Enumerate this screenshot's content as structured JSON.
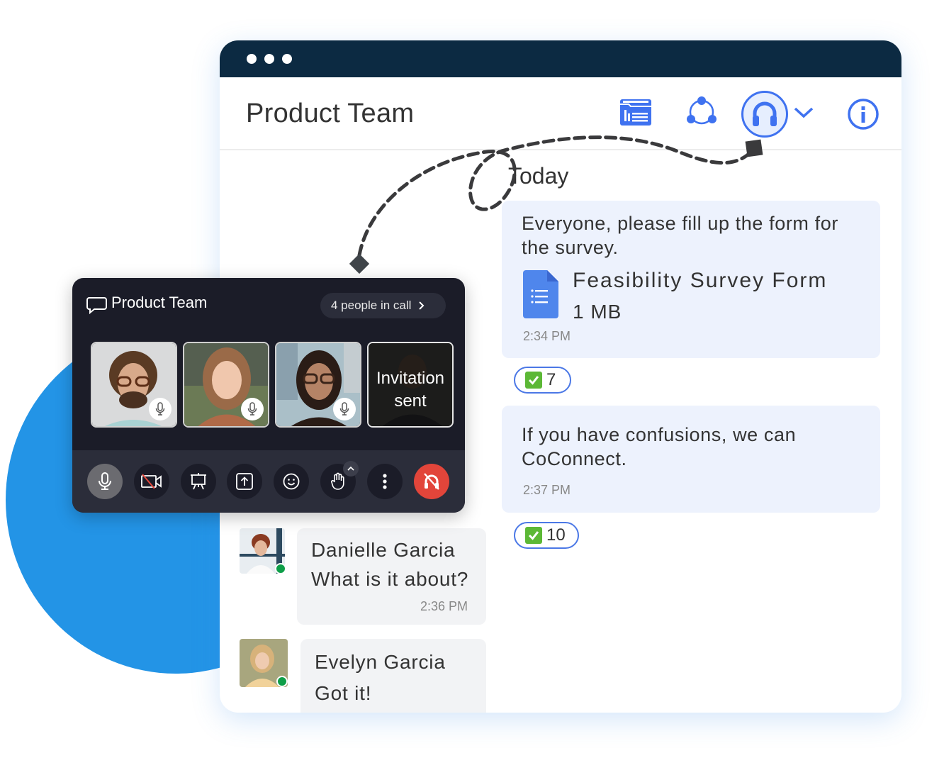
{
  "colors": {
    "accent": "#3f72f0",
    "titlebar": "#0c2a42",
    "circle": "#2394e6",
    "end_call": "#e2453a",
    "online": "#0e9e48",
    "reaction_check": "#5cb836"
  },
  "window": {
    "title": "Product Team",
    "header_icons": [
      "folder-list-icon",
      "share-network-icon",
      "headset-icon",
      "chevron-down-icon",
      "info-icon"
    ]
  },
  "chat": {
    "date_divider": "Today",
    "messages": [
      {
        "text": "Everyone, please fill up the form for the survey.",
        "text_line1": "Everyone, please fill up the form for",
        "text_line2": "the survey.",
        "attachment": {
          "icon": "google-forms-icon",
          "name": "Feasibility Survey Form",
          "size": "1 MB"
        },
        "time": "2:34 PM",
        "reaction": {
          "emoji": "check-mark",
          "count": "7"
        }
      },
      {
        "text": "If you have confusions, we can CoConnect.",
        "text_line1": "If you have confusions, we can",
        "text_line2": "CoConnect.",
        "time": "2:37 PM",
        "reaction": {
          "emoji": "check-mark",
          "count": "10"
        }
      }
    ],
    "replies": [
      {
        "name": "Danielle Garcia",
        "text": "What is it about?",
        "time": "2:36 PM",
        "status": "online"
      },
      {
        "name": "Evelyn Garcia",
        "text": "Got it!",
        "status": "online"
      }
    ]
  },
  "call": {
    "title": "Product Team",
    "people_label": "4 people in call",
    "participants": [
      {
        "status": "mic"
      },
      {
        "status": "mic"
      },
      {
        "status": "mic"
      },
      {
        "status": "invited",
        "label_line1": "Invitation",
        "label_line2": "sent"
      }
    ],
    "controls": [
      "microphone",
      "camera-off",
      "present",
      "share-screen",
      "reactions",
      "raise-hand",
      "more",
      "leave-call"
    ]
  }
}
